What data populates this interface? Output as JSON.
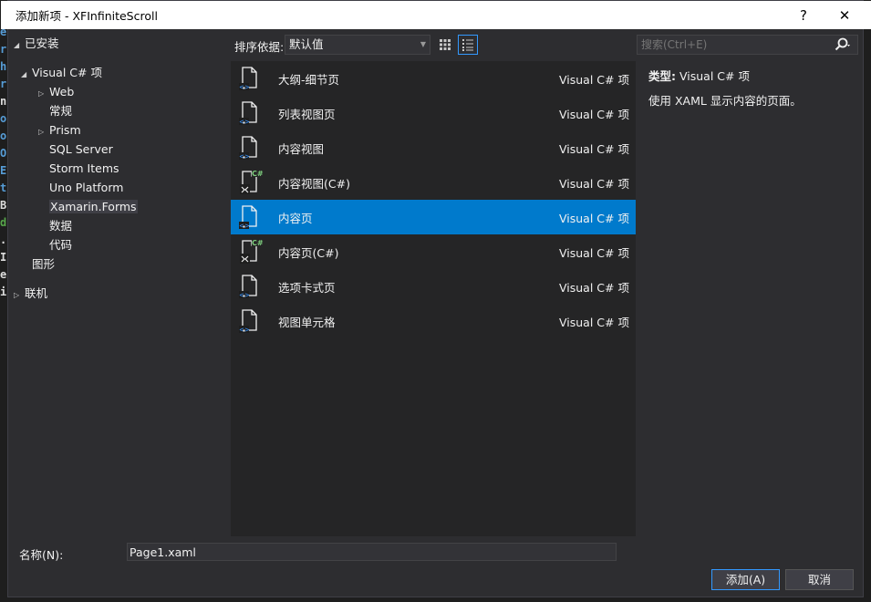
{
  "window": {
    "title": "添加新项 - XFInfiniteScroll",
    "help": "?",
    "close": "✕"
  },
  "editor_chars": [
    {
      "ch": "e",
      "color": "#569cd6"
    },
    {
      "ch": "r",
      "color": "#569cd6"
    },
    {
      "ch": "h",
      "color": "#569cd6"
    },
    {
      "ch": "r",
      "color": "#569cd6"
    },
    {
      "ch": "n",
      "color": "#dcdcdc"
    },
    {
      "ch": "o",
      "color": "#569cd6"
    },
    {
      "ch": "o",
      "color": "#569cd6"
    },
    {
      "ch": "O",
      "color": "#569cd6"
    },
    {
      "ch": "E",
      "color": "#569cd6"
    },
    {
      "ch": "t",
      "color": "#569cd6"
    },
    {
      "ch": "B",
      "color": "#dcdcdc"
    },
    {
      "ch": "d",
      "color": "#57a64a"
    },
    {
      "ch": ".",
      "color": "#dcdcdc"
    },
    {
      "ch": "I",
      "color": "#dcdcdc"
    },
    {
      "ch": "e",
      "color": "#dcdcdc"
    },
    {
      "ch": "i",
      "color": "#dcdcdc"
    }
  ],
  "tree": {
    "installed": "已安装",
    "visual_csharp": "Visual C# 项",
    "web": "Web",
    "general": "常规",
    "prism": "Prism",
    "sql_server": "SQL Server",
    "storm_items": "Storm Items",
    "uno_platform": "Uno Platform",
    "xamarin_forms": "Xamarin.Forms",
    "data": "数据",
    "code": "代码",
    "graphics": "图形",
    "online": "联机"
  },
  "toolbar": {
    "sort_label": "排序依据:",
    "sort_value": "默认值"
  },
  "search": {
    "placeholder": "搜索(Ctrl+E)"
  },
  "items": [
    {
      "name": "大纲-细节页",
      "category": "Visual C# 项",
      "icon": "xaml-page-icon"
    },
    {
      "name": "列表视图页",
      "category": "Visual C# 项",
      "icon": "xaml-page-icon"
    },
    {
      "name": "内容视图",
      "category": "Visual C# 项",
      "icon": "xaml-page-icon"
    },
    {
      "name": "内容视图(C#)",
      "category": "Visual C# 项",
      "icon": "csharp-page-icon"
    },
    {
      "name": "内容页",
      "category": "Visual C# 项",
      "icon": "xaml-page-icon"
    },
    {
      "name": "内容页(C#)",
      "category": "Visual C# 项",
      "icon": "csharp-page-icon"
    },
    {
      "name": "选项卡式页",
      "category": "Visual C# 项",
      "icon": "xaml-page-icon"
    },
    {
      "name": "视图单元格",
      "category": "Visual C# 项",
      "icon": "xaml-page-icon"
    }
  ],
  "selected_index": 4,
  "details": {
    "type_label": "类型:",
    "type_value": "Visual C# 项",
    "description": "使用 XAML 显示内容的页面。"
  },
  "footer": {
    "name_label": "名称(N):",
    "name_value": "Page1.xaml",
    "add": "添加(A)",
    "cancel": "取消"
  },
  "colors": {
    "accent": "#007acc",
    "background": "#2d2d30",
    "list_bg": "#252526"
  }
}
